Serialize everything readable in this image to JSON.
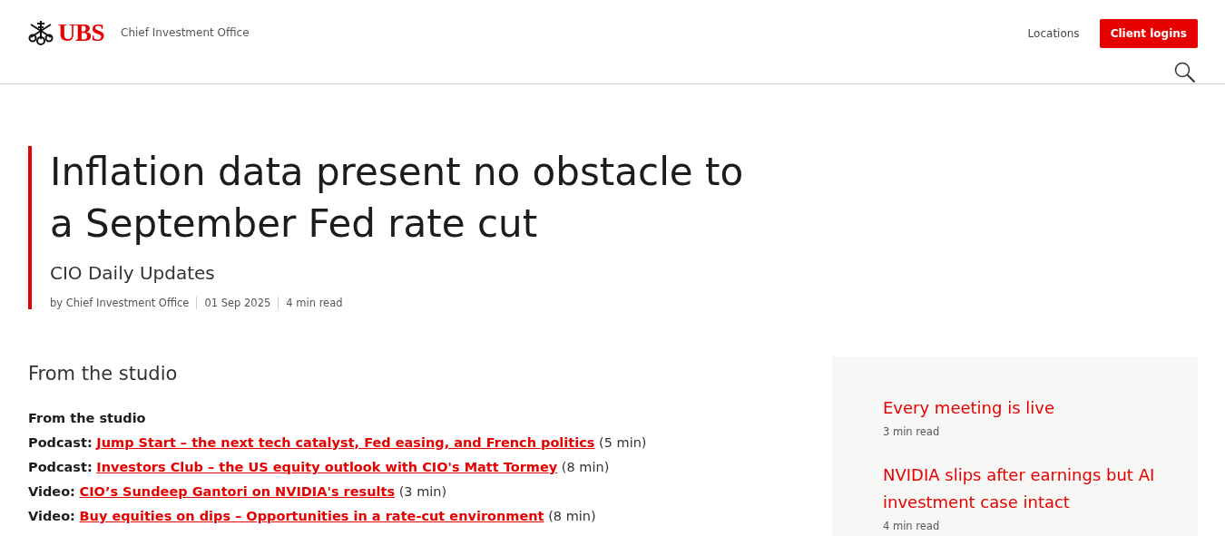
{
  "header": {
    "logo_text": "UBS",
    "section_title": "Chief Investment Office",
    "nav_link": "Locations",
    "login_button": "Client logins"
  },
  "article": {
    "title": "Inflation data present no obstacle to a September Fed rate cut",
    "category": "CIO Daily Updates",
    "meta": [
      "by Chief Investment Office",
      "01 Sep 2025",
      "4 min read"
    ]
  },
  "studio": {
    "heading": "From the studio",
    "subheading": "From the studio",
    "items": [
      {
        "type_label": "Podcast:",
        "link": "Jump Start – the next tech catalyst, Fed easing, and French politics",
        "duration": "(5 min)"
      },
      {
        "type_label": "Podcast:",
        "link": "Investors Club – the US equity outlook with CIO's Matt Tormey",
        "duration": "(8 min)"
      },
      {
        "type_label": "Video:",
        "link": "CIO’s Sundeep Gantori on NVIDIA's results",
        "duration": "(3 min)"
      },
      {
        "type_label": "Video:",
        "link": "Buy equities on dips – Opportunities in a rate-cut environment",
        "duration": "(8 min)"
      }
    ]
  },
  "sidebar": {
    "items": [
      {
        "title": "Every meeting is live",
        "meta": "3 min read"
      },
      {
        "title": "NVIDIA slips after earnings but AI investment case intact",
        "meta": "4 min read"
      }
    ]
  }
}
